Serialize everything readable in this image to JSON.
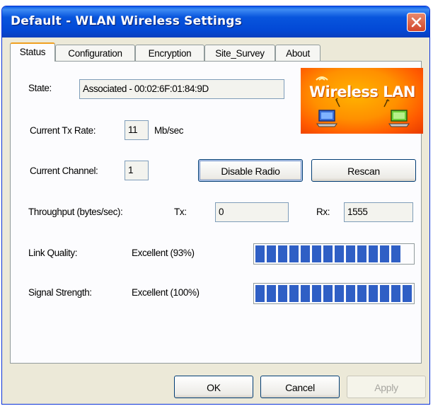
{
  "window": {
    "title": "Default - WLAN Wireless Settings"
  },
  "tabs": [
    {
      "label": "Status"
    },
    {
      "label": "Configuration"
    },
    {
      "label": "Encryption"
    },
    {
      "label": "Site_Survey"
    },
    {
      "label": "About"
    }
  ],
  "active_tab": "Status",
  "logo": {
    "text": "Wireless LAN"
  },
  "status": {
    "state_label": "State:",
    "state_value": "Associated - 00:02:6F:01:84:9D",
    "tx_rate_label": "Current Tx Rate:",
    "tx_rate_value": "11",
    "tx_rate_unit": "Mb/sec",
    "channel_label": "Current Channel:",
    "channel_value": "1",
    "throughput_label": "Throughput (bytes/sec):",
    "tx_label": "Tx:",
    "tx_value": "0",
    "rx_label": "Rx:",
    "rx_value": "1555",
    "link_quality_label": "Link Quality:",
    "link_quality_text": "Excellent (93%)",
    "link_quality_percent": 93,
    "signal_strength_label": "Signal Strength:",
    "signal_strength_text": "Excellent (100%)",
    "signal_strength_percent": 100
  },
  "buttons": {
    "disable_radio": "Disable Radio",
    "rescan": "Rescan",
    "ok": "OK",
    "cancel": "Cancel",
    "apply": "Apply"
  },
  "colors": {
    "title_bar": "#0a55e0",
    "close_button": "#d2462a",
    "active_tab_highlight": "#f0a020",
    "progress_fill": "#2f5fc5",
    "logo_background": "#ff9000"
  },
  "icons": [
    "close-icon",
    "laptop-icon",
    "wifi-signal-icon"
  ]
}
